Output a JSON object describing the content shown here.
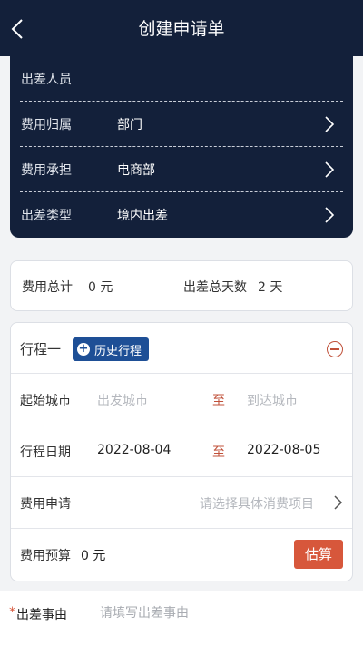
{
  "header": {
    "title": "创建申请单"
  },
  "info": {
    "traveler_label": "出差人员",
    "rows": [
      {
        "label": "费用归属",
        "value": "部门"
      },
      {
        "label": "费用承担",
        "value": "电商部"
      },
      {
        "label": "出差类型",
        "value": "境内出差"
      }
    ]
  },
  "summary": {
    "cost_total_label": "费用总计",
    "cost_total_value": "0 元",
    "days_label": "出差总天数",
    "days_value": "2 天"
  },
  "itinerary": {
    "title": "行程一",
    "history_label": "历史行程",
    "city_label": "起始城市",
    "from_city_placeholder": "出发城市",
    "to_label": "至",
    "to_city_placeholder": "到达城市",
    "date_label": "行程日期",
    "start_date": "2022-08-04",
    "end_date": "2022-08-05",
    "expense_label": "费用申请",
    "expense_placeholder": "请选择具体消费项目",
    "budget_label": "费用预算",
    "budget_value": "0 元",
    "estimate_label": "估算"
  },
  "reason": {
    "required_mark": "*",
    "label": "出差事由",
    "placeholder": "请填写出差事由"
  },
  "colors": {
    "navy": "#13203a",
    "accent": "#d7573b",
    "blue": "#1e4f96"
  }
}
